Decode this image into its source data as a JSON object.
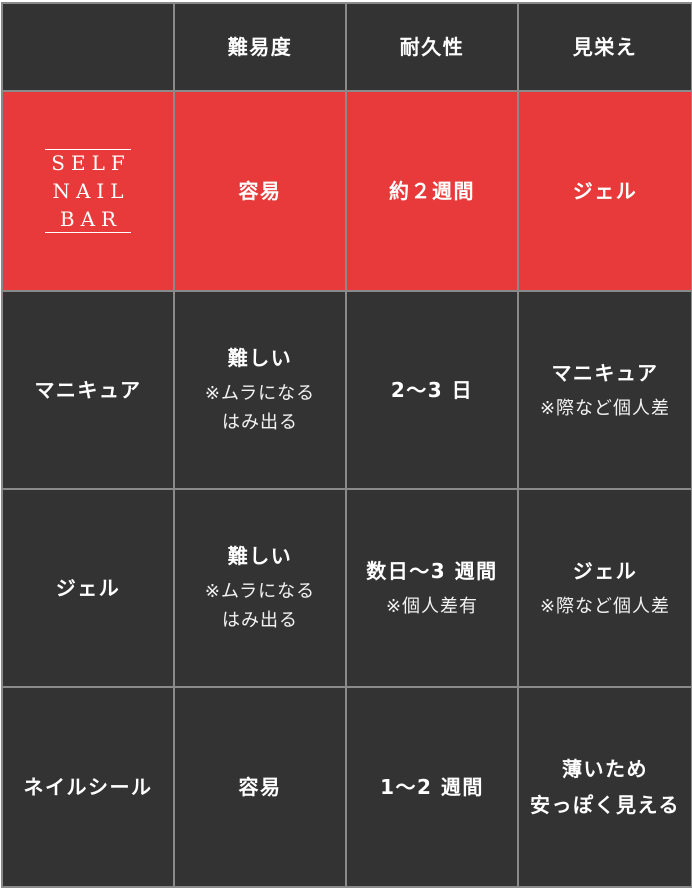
{
  "header": {
    "corner": "",
    "col_difficulty": "難易度",
    "col_durability": "耐久性",
    "col_appearance": "見栄え"
  },
  "rows": {
    "self_nail_bar": {
      "logo_line1": "SELF",
      "logo_line2": "NAIL",
      "logo_line3": "BAR",
      "difficulty": "容易",
      "durability": "約２週間",
      "appearance": "ジェル"
    },
    "manicure": {
      "name": "マニキュア",
      "difficulty": "難しい",
      "difficulty_note1": "※ムラになる",
      "difficulty_note2": "はみ出る",
      "durability": "2〜3 日",
      "appearance": "マニキュア",
      "appearance_note": "※際など個人差"
    },
    "gel": {
      "name": "ジェル",
      "difficulty": "難しい",
      "difficulty_note1": "※ムラになる",
      "difficulty_note2": "はみ出る",
      "durability": "数日〜3 週間",
      "durability_note": "※個人差有",
      "appearance": "ジェル",
      "appearance_note": "※際など個人差"
    },
    "nail_seal": {
      "name": "ネイルシール",
      "difficulty": "容易",
      "durability": "1〜2 週間",
      "appearance_line1": "薄いため",
      "appearance_line2": "安っぽく見える"
    }
  },
  "colors": {
    "dark_cell": "#333333",
    "highlight_row": "#e83a3a",
    "grid_line": "#8a8a8a",
    "text": "#ffffff"
  }
}
